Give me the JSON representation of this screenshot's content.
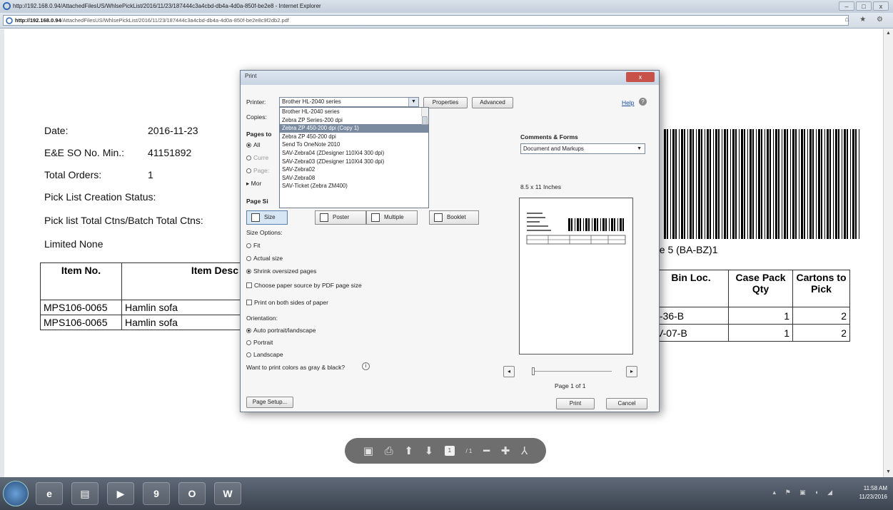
{
  "window": {
    "title": "http://192.168.0.94/AttachedFilesUS/WhlsePickList/2016/11/23/187444c3a4cbd-db4a-4d0a-850f-be2e8 - Internet Explorer",
    "minimize": "–",
    "maximize": "□",
    "close": "x"
  },
  "address": {
    "host": "http://192.168.0.94",
    "path": "/AttachedFilesUS/WhlsePickList/2016/11/23/187444c3a4cbd-db4a-4d0a-850f-be2e8c9f2db2.pdf",
    "nav_icons": "⌂ ★ ⚙"
  },
  "doc": {
    "date_label": "Date:",
    "date_value": "2016-11-23",
    "so_label": "E&E SO No. Min.:",
    "so_value": "41151892",
    "orders_label": "Total Orders:",
    "orders_value": "1",
    "status_label": "Pick List Creation Status:",
    "ctns_label": "Pick list Total Ctns/Batch Total Ctns:",
    "limited": "Limited None",
    "table_headers": [
      "Item No.",
      "Item Desc"
    ],
    "rows": [
      {
        "item": "MPS106-0065",
        "desc": "Hamlin sofa"
      },
      {
        "item": "MPS106-0065",
        "desc": "Hamlin sofa"
      }
    ],
    "barcode_label": "ne 5 (BA-BZ)1",
    "right_headers": [
      "Bin Loc.",
      "Case Pack Qty",
      "Cartons to Pick"
    ],
    "right_rows": [
      {
        "bin": "/-36-B",
        "qty": "1",
        "cartons": "2"
      },
      {
        "bin": "V-07-B",
        "qty": "1",
        "cartons": "2"
      }
    ]
  },
  "pdf_toolbar": {
    "page_current": "1",
    "page_total": "/ 1"
  },
  "print_dialog": {
    "title": "Print",
    "close": "x",
    "printer_label": "Printer:",
    "printer_value": "Brother HL-2040 series",
    "properties_button": "Properties",
    "advanced_button": "Advanced",
    "help_link": "Help",
    "copies_label": "Copies:",
    "pages_label": "Pages to",
    "all_label": "All",
    "current_label": "Curre",
    "pages_option_label": "Page:",
    "more_label": "Mor",
    "page_size_label": "Page Si",
    "printer_options": [
      "Brother HL-2040 series",
      "Zebra ZP Series-200 dpi",
      "Zebra ZP 450-200 dpi (Copy 1)",
      "Zebra ZP 450-200 dpi",
      "Send To OneNote 2010",
      "SAV-Zebra04 (ZDesigner 110Xi4 300 dpi)",
      "SAV-Zebra03 (ZDesigner 110Xi4 300 dpi)",
      "SAV-Zebra02",
      "SAV-Zebra08",
      "SAV-Ticket (Zebra ZM400)"
    ],
    "selected_option_index": 2,
    "tabs": [
      "Size",
      "Poster",
      "Multiple",
      "Booklet"
    ],
    "size_options_label": "Size Options:",
    "fit": "Fit",
    "actual_size": "Actual size",
    "shrink": "Shrink oversized pages",
    "paper_source": "Choose paper source by PDF page size",
    "both_sides": "Print on both sides of paper",
    "orientation_label": "Orientation:",
    "auto": "Auto portrait/landscape",
    "portrait": "Portrait",
    "landscape": "Landscape",
    "gray_question": "Want to print colors as gray & black?",
    "comments_label": "Comments & Forms",
    "comments_value": "Document and Markups",
    "paper_size": "8.5 x 11 Inches",
    "page_of": "Page 1 of 1",
    "page_setup_button": "Page Setup...",
    "print_button": "Print",
    "cancel_button": "Cancel"
  },
  "taskbar": {
    "time": "11:58 AM",
    "date": "11/23/2016",
    "word_label": "W",
    "outlook_label": "O"
  }
}
